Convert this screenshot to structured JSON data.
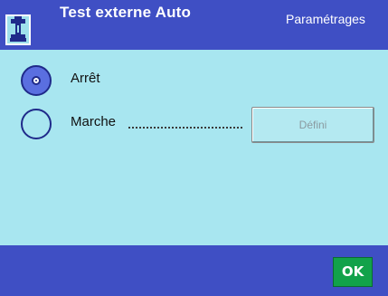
{
  "header": {
    "title": "Test externe Auto",
    "section": "Paramétrages",
    "icon": "weight-test-icon"
  },
  "options": [
    {
      "label": "Arrêt",
      "selected": true
    },
    {
      "label": "Marche",
      "selected": false
    }
  ],
  "define_button": {
    "label": "Défini",
    "enabled": false
  },
  "footer": {
    "ok_label": "OK"
  },
  "colors": {
    "header_bg": "#3f4fc4",
    "content_bg": "#a8e6f0",
    "selected_radio": "#5a6fe0",
    "ok_button": "#12a24a"
  }
}
